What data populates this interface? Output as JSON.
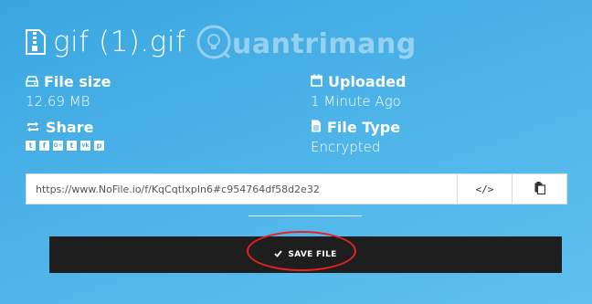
{
  "file": {
    "name": "gif (1).gif",
    "file_size_label": "File size",
    "file_size_value": "12.69 MB",
    "uploaded_label": "Uploaded",
    "uploaded_value": "1 Minute Ago",
    "share_label": "Share",
    "file_type_label": "File Type",
    "file_type_value": "Encrypted"
  },
  "watermark": {
    "text": "uantrimang"
  },
  "share_icons": [
    "twitter-icon",
    "facebook-icon",
    "google-plus-icon",
    "tumblr-icon",
    "vk-icon",
    "pinterest-icon"
  ],
  "share_glyphs": [
    "t",
    "f",
    "G+",
    "t",
    "vk",
    "p"
  ],
  "link": {
    "url": "https://www.NoFile.io/f/KqCqtIxpIn6#c954764df58d2e32"
  },
  "actions": {
    "embed_glyph": "</>",
    "save_label": "SAVE FILE"
  },
  "colors": {
    "background": "#4cb3e8",
    "save_button": "#1e1e1e",
    "highlight": "#e8221f"
  }
}
